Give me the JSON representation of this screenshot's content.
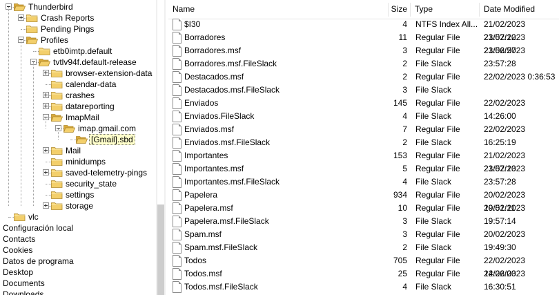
{
  "tree": {
    "nodes": [
      {
        "label": "Thunderbird",
        "depth": 0,
        "expander": "minus",
        "open": true
      },
      {
        "label": "Crash Reports",
        "depth": 1,
        "expander": "plus",
        "open": false
      },
      {
        "label": "Pending Pings",
        "depth": 1,
        "expander": "none",
        "open": false
      },
      {
        "label": "Profiles",
        "depth": 1,
        "expander": "minus",
        "open": true
      },
      {
        "label": "etb0imtp.default",
        "depth": 2,
        "expander": "none",
        "open": false
      },
      {
        "label": "tvtlv94f.default-release",
        "depth": 2,
        "expander": "minus",
        "open": true
      },
      {
        "label": "browser-extension-data",
        "depth": 3,
        "expander": "plus",
        "open": false
      },
      {
        "label": "calendar-data",
        "depth": 3,
        "expander": "none",
        "open": false
      },
      {
        "label": "crashes",
        "depth": 3,
        "expander": "plus",
        "open": false
      },
      {
        "label": "datareporting",
        "depth": 3,
        "expander": "plus",
        "open": false
      },
      {
        "label": "ImapMail",
        "depth": 3,
        "expander": "minus",
        "open": true
      },
      {
        "label": "imap.gmail.com",
        "depth": 4,
        "expander": "minus",
        "open": true
      },
      {
        "label": "[Gmail].sbd",
        "depth": 5,
        "expander": "none",
        "open": true,
        "selected": true
      },
      {
        "label": "Mail",
        "depth": 3,
        "expander": "plus",
        "open": false
      },
      {
        "label": "minidumps",
        "depth": 3,
        "expander": "none",
        "open": false
      },
      {
        "label": "saved-telemetry-pings",
        "depth": 3,
        "expander": "plus",
        "open": false
      },
      {
        "label": "security_state",
        "depth": 3,
        "expander": "none",
        "open": false
      },
      {
        "label": "settings",
        "depth": 3,
        "expander": "none",
        "open": false
      },
      {
        "label": "storage",
        "depth": 3,
        "expander": "plus",
        "open": false
      },
      {
        "label": "vlc",
        "depth": 0,
        "expander": "none",
        "open": false
      }
    ],
    "plain_items": [
      "Configuración local",
      "Contacts",
      "Cookies",
      "Datos de programa",
      "Desktop",
      "Documents",
      "Downloads"
    ]
  },
  "list": {
    "columns": {
      "name": "Name",
      "size": "Size",
      "type": "Type",
      "date": "Date Modified"
    },
    "rows": [
      {
        "name": "$I30",
        "size": "4",
        "type": "NTFS Index All...",
        "date": "21/02/2023 23:57:12"
      },
      {
        "name": "Borradores",
        "size": "11",
        "type": "Regular File",
        "date": "21/02/2023 23:56:57"
      },
      {
        "name": "Borradores.msf",
        "size": "3",
        "type": "Regular File",
        "date": "21/02/2023 23:57:28"
      },
      {
        "name": "Borradores.msf.FileSlack",
        "size": "2",
        "type": "File Slack",
        "date": ""
      },
      {
        "name": "Destacados.msf",
        "size": "2",
        "type": "Regular File",
        "date": "22/02/2023 0:36:53"
      },
      {
        "name": "Destacados.msf.FileSlack",
        "size": "3",
        "type": "File Slack",
        "date": ""
      },
      {
        "name": "Enviados",
        "size": "145",
        "type": "Regular File",
        "date": "22/02/2023 14:26:00"
      },
      {
        "name": "Enviados.FileSlack",
        "size": "4",
        "type": "File Slack",
        "date": ""
      },
      {
        "name": "Enviados.msf",
        "size": "7",
        "type": "Regular File",
        "date": "22/02/2023 16:25:19"
      },
      {
        "name": "Enviados.msf.FileSlack",
        "size": "2",
        "type": "File Slack",
        "date": ""
      },
      {
        "name": "Importantes",
        "size": "153",
        "type": "Regular File",
        "date": "21/02/2023 23:57:13"
      },
      {
        "name": "Importantes.msf",
        "size": "5",
        "type": "Regular File",
        "date": "21/02/2023 23:57:28"
      },
      {
        "name": "Importantes.msf.FileSlack",
        "size": "4",
        "type": "File Slack",
        "date": ""
      },
      {
        "name": "Papelera",
        "size": "934",
        "type": "Regular File",
        "date": "20/02/2023 19:51:11"
      },
      {
        "name": "Papelera.msf",
        "size": "10",
        "type": "Regular File",
        "date": "20/02/2023 19:57:14"
      },
      {
        "name": "Papelera.msf.FileSlack",
        "size": "3",
        "type": "File Slack",
        "date": ""
      },
      {
        "name": "Spam.msf",
        "size": "3",
        "type": "Regular File",
        "date": "20/02/2023 19:49:30"
      },
      {
        "name": "Spam.msf.FileSlack",
        "size": "2",
        "type": "File Slack",
        "date": ""
      },
      {
        "name": "Todos",
        "size": "705",
        "type": "Regular File",
        "date": "22/02/2023 14:26:03"
      },
      {
        "name": "Todos.msf",
        "size": "25",
        "type": "Regular File",
        "date": "22/02/2023 16:30:51"
      },
      {
        "name": "Todos.msf.FileSlack",
        "size": "4",
        "type": "File Slack",
        "date": ""
      }
    ]
  },
  "colors": {
    "folder": "#f3cf6b",
    "folder_dark": "#d9a93b",
    "selection": "#ffffcc",
    "scroll_track": "#f0f0f0",
    "scroll_thumb": "#cdcdcd"
  }
}
